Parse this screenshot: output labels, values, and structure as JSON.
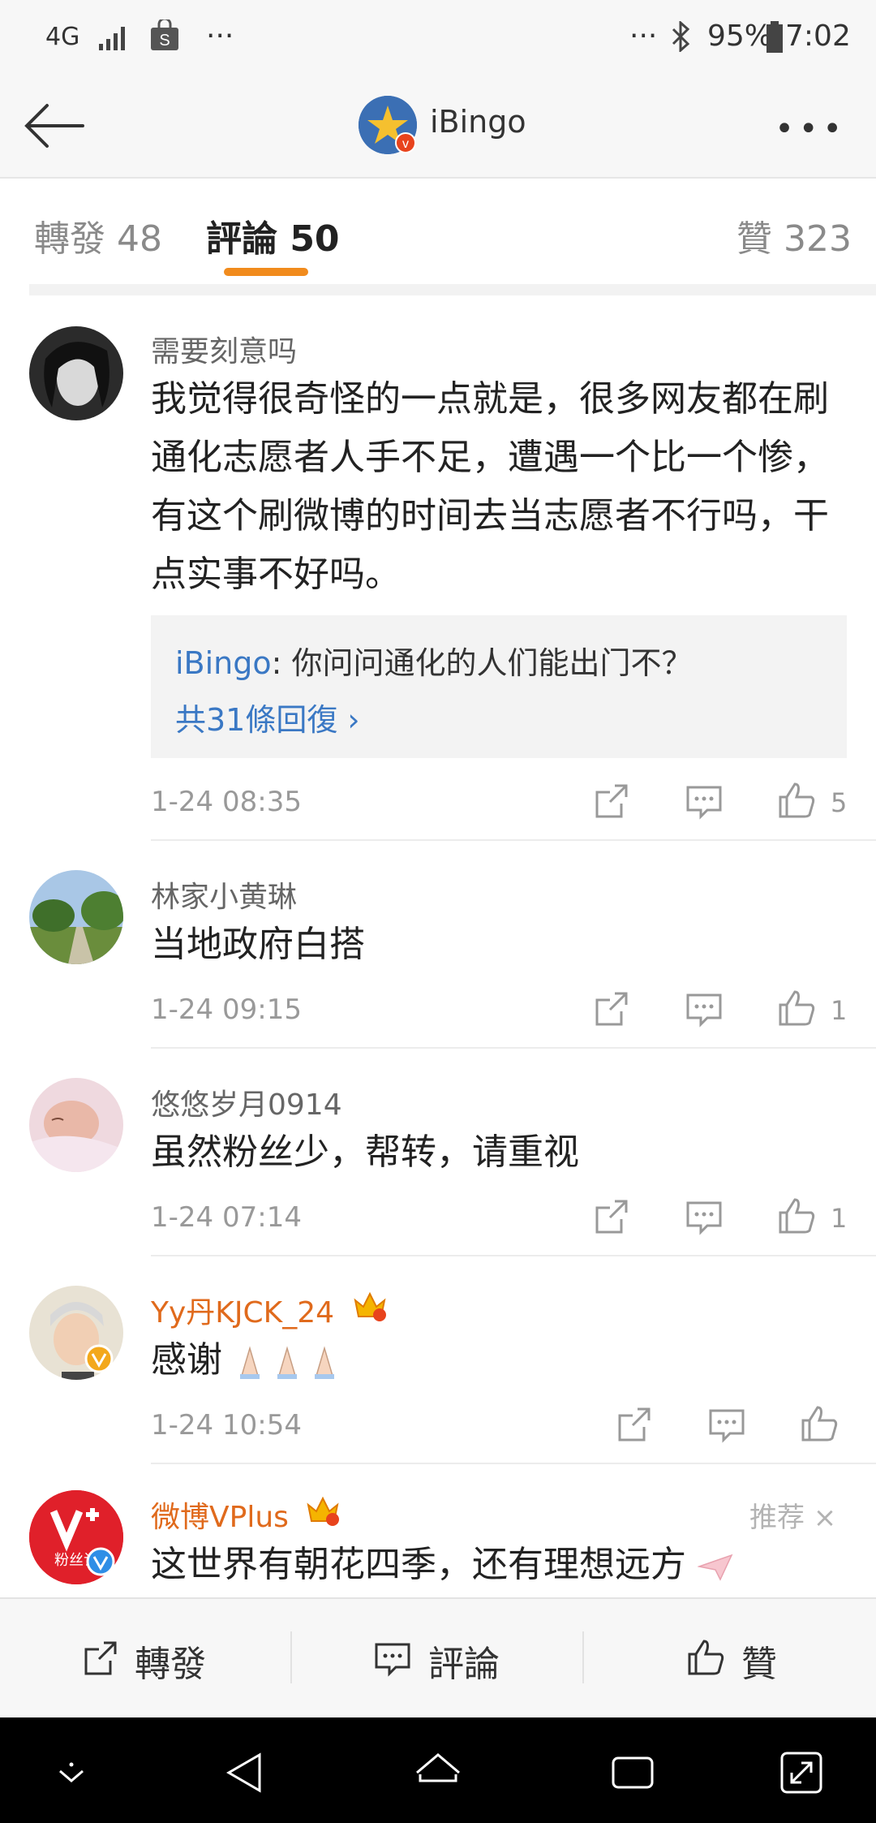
{
  "status": {
    "network": "4G",
    "dots_left": "···",
    "dots_right": "···",
    "battery": "95%",
    "time": "7:02"
  },
  "header": {
    "title": "iBingo"
  },
  "tabs": [
    {
      "label": "轉發 48"
    },
    {
      "label": "評論 50"
    },
    {
      "label": "贊 323"
    }
  ],
  "comments": [
    {
      "user": "需要刻意吗",
      "lines": [
        "我觉得很奇怪的一点就是，很多网友都在刷",
        "通化志愿者人手不足，遭遇一个比一个惨，",
        "有这个刷微博的时间去当志愿者不行吗，干",
        "点实事不好吗。"
      ],
      "reply_user": "iBingo",
      "reply_text": ": 你问问通化的人们能出门不？",
      "reply_more": "共31條回復 ›",
      "time": "1-24 08:35",
      "likes": "5"
    },
    {
      "user": "林家小黄琳",
      "text": "当地政府白搭",
      "time": "1-24 09:15",
      "likes": "1"
    },
    {
      "user": "悠悠岁月0914",
      "text": "虽然粉丝少，帮转，请重视",
      "time": "1-24 07:14",
      "likes": "1"
    },
    {
      "user": "Yy丹KJCK_24",
      "text": "感谢",
      "time": "1-24 10:54",
      "likes": ""
    },
    {
      "user": "微博VPlus",
      "text": "这世界有朝花四季，还有理想远方",
      "badge": "粉丝订",
      "recommend": "推荐 ×"
    }
  ],
  "bottom_bar": {
    "repost": "轉發",
    "comment": "評論",
    "like": "贊"
  }
}
